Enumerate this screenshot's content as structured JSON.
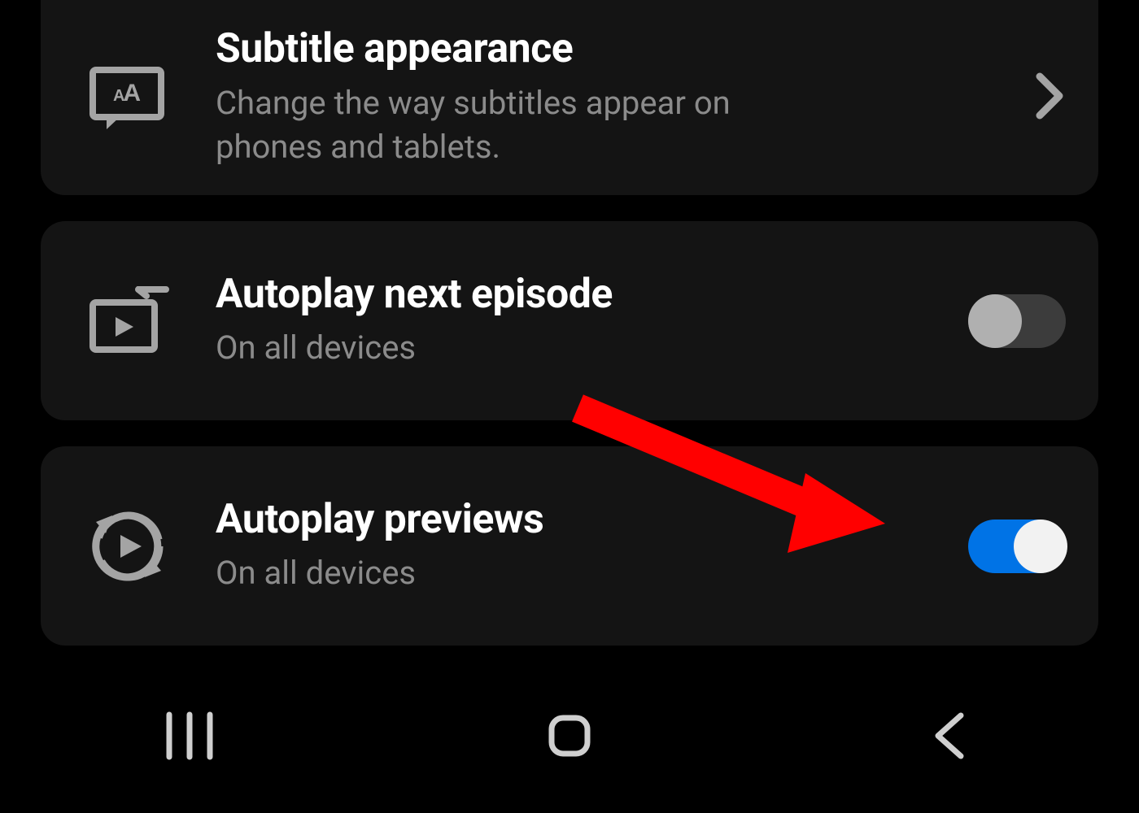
{
  "settings": {
    "subtitle": {
      "title": "Subtitle appearance",
      "desc": "Change the way subtitles appear on phones and tablets."
    },
    "autoplay_next": {
      "title": "Autoplay next episode",
      "desc": "On all devices",
      "enabled": false
    },
    "autoplay_previews": {
      "title": "Autoplay previews",
      "desc": "On all devices",
      "enabled": true
    }
  },
  "colors": {
    "card_bg": "#141414",
    "toggle_on": "#0073e6",
    "toggle_off_track": "#3c3c3c",
    "annotation": "#ff0000"
  }
}
